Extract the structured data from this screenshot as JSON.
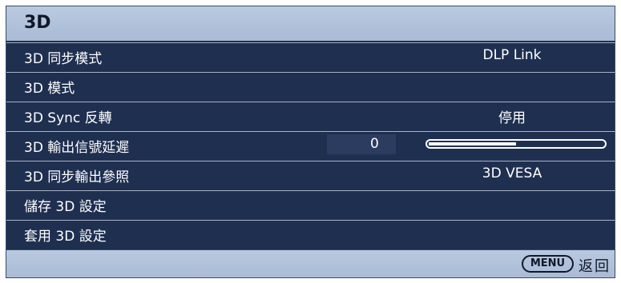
{
  "title": "3D",
  "menu_items": [
    {
      "label": "3D 同步模式",
      "value": "DLP Link"
    },
    {
      "label": "3D 模式",
      "value": ""
    },
    {
      "label": "3D Sync 反轉",
      "value": "停用"
    },
    {
      "label": "3D 輸出信號延遲",
      "value": "0",
      "slider_fraction": 0.5
    },
    {
      "label": "3D 同步輸出參照",
      "value": "3D VESA"
    },
    {
      "label": "儲存 3D 設定",
      "value": ""
    },
    {
      "label": "套用 3D 設定",
      "value": ""
    }
  ],
  "footer": {
    "menu_button": "MENU",
    "back_label": "返回"
  },
  "colors": {
    "panel": "#1f2f50",
    "bar": "#b0c1da"
  }
}
